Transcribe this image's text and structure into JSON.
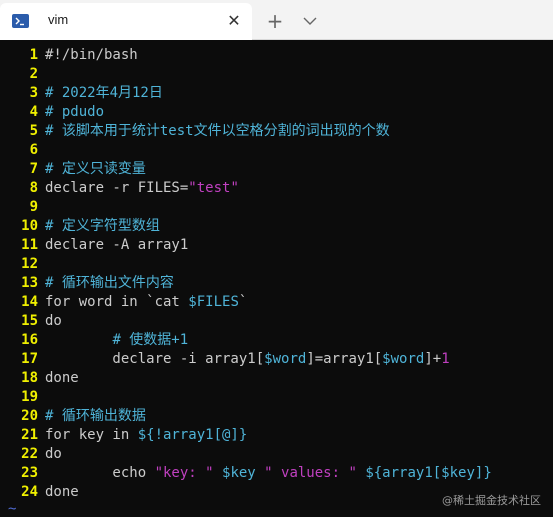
{
  "tab": {
    "title": "vim",
    "close_glyph": "✕"
  },
  "new_tab_glyph": "+",
  "lines": [
    {
      "n": "1",
      "segs": [
        {
          "t": "#!/bin/bash",
          "c": ""
        }
      ]
    },
    {
      "n": "2",
      "segs": []
    },
    {
      "n": "3",
      "segs": [
        {
          "t": "# 2022年4月12日",
          "c": "c-comment"
        }
      ]
    },
    {
      "n": "4",
      "segs": [
        {
          "t": "# pdudo",
          "c": "c-comment"
        }
      ]
    },
    {
      "n": "5",
      "segs": [
        {
          "t": "# 该脚本用于统计test文件以空格分割的词出现的个数",
          "c": "c-comment"
        }
      ]
    },
    {
      "n": "6",
      "segs": []
    },
    {
      "n": "7",
      "segs": [
        {
          "t": "# 定义只读变量",
          "c": "c-comment"
        }
      ]
    },
    {
      "n": "8",
      "segs": [
        {
          "t": "declare -r FILES=",
          "c": ""
        },
        {
          "t": "\"test\"",
          "c": "c-string"
        }
      ]
    },
    {
      "n": "9",
      "segs": []
    },
    {
      "n": "10",
      "segs": [
        {
          "t": "# 定义字符型数组",
          "c": "c-comment"
        }
      ]
    },
    {
      "n": "11",
      "segs": [
        {
          "t": "declare -A array1",
          "c": ""
        }
      ]
    },
    {
      "n": "12",
      "segs": []
    },
    {
      "n": "13",
      "segs": [
        {
          "t": "# 循环输出文件内容",
          "c": "c-comment"
        }
      ]
    },
    {
      "n": "14",
      "segs": [
        {
          "t": "for word in `cat ",
          "c": ""
        },
        {
          "t": "$FILES",
          "c": "c-var"
        },
        {
          "t": "`",
          "c": ""
        }
      ]
    },
    {
      "n": "15",
      "segs": [
        {
          "t": "do",
          "c": ""
        }
      ]
    },
    {
      "n": "16",
      "segs": [
        {
          "t": "        ",
          "c": ""
        },
        {
          "t": "# 使数据+1",
          "c": "c-comment"
        }
      ]
    },
    {
      "n": "17",
      "segs": [
        {
          "t": "        declare -i array1[",
          "c": ""
        },
        {
          "t": "$word",
          "c": "c-var"
        },
        {
          "t": "]=array1[",
          "c": ""
        },
        {
          "t": "$word",
          "c": "c-var"
        },
        {
          "t": "]+",
          "c": ""
        },
        {
          "t": "1",
          "c": "c-string"
        }
      ]
    },
    {
      "n": "18",
      "segs": [
        {
          "t": "done",
          "c": ""
        }
      ]
    },
    {
      "n": "19",
      "segs": []
    },
    {
      "n": "20",
      "segs": [
        {
          "t": "# 循环输出数据",
          "c": "c-comment"
        }
      ]
    },
    {
      "n": "21",
      "segs": [
        {
          "t": "for key in ",
          "c": ""
        },
        {
          "t": "${!array1[@]}",
          "c": "c-var"
        }
      ]
    },
    {
      "n": "22",
      "segs": [
        {
          "t": "do",
          "c": ""
        }
      ]
    },
    {
      "n": "23",
      "segs": [
        {
          "t": "        echo ",
          "c": ""
        },
        {
          "t": "\"key: \" ",
          "c": "c-string"
        },
        {
          "t": "$key",
          "c": "c-var"
        },
        {
          "t": " \" values: \" ",
          "c": "c-string"
        },
        {
          "t": "${array1[$key]}",
          "c": "c-var"
        }
      ]
    },
    {
      "n": "24",
      "segs": [
        {
          "t": "done",
          "c": ""
        }
      ]
    }
  ],
  "tilde": "~",
  "watermark": "@稀土掘金技术社区"
}
